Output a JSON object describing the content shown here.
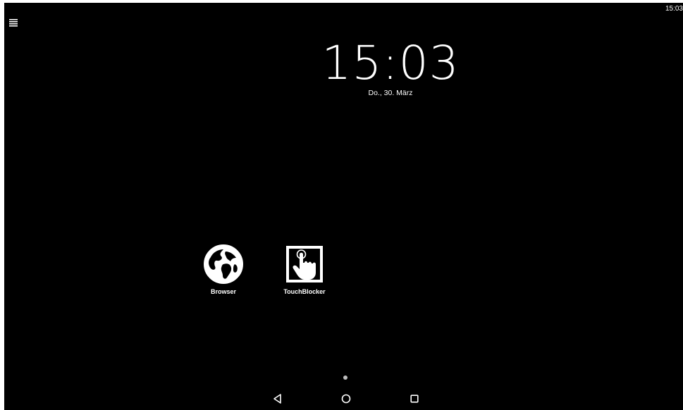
{
  "status_bar": {
    "time": "15:03"
  },
  "launcher": {
    "menu_icon": "all-apps-menu-icon",
    "clock": {
      "time": "15:03",
      "date": "Do., 30. März"
    },
    "apps": [
      {
        "label": "Browser",
        "icon": "globe-icon"
      },
      {
        "label": "TouchBlocker",
        "icon": "touch-hand-icon"
      }
    ],
    "page_indicator": {
      "pages": 1,
      "current": 1
    }
  },
  "navigation_bar": {
    "buttons": [
      {
        "name": "back",
        "icon": "back-triangle-icon"
      },
      {
        "name": "home",
        "icon": "home-circle-icon"
      },
      {
        "name": "recents",
        "icon": "recents-square-icon"
      }
    ]
  },
  "colors": {
    "background": "#000000",
    "foreground": "#ffffff",
    "page_dot": "#bdbdbd"
  }
}
